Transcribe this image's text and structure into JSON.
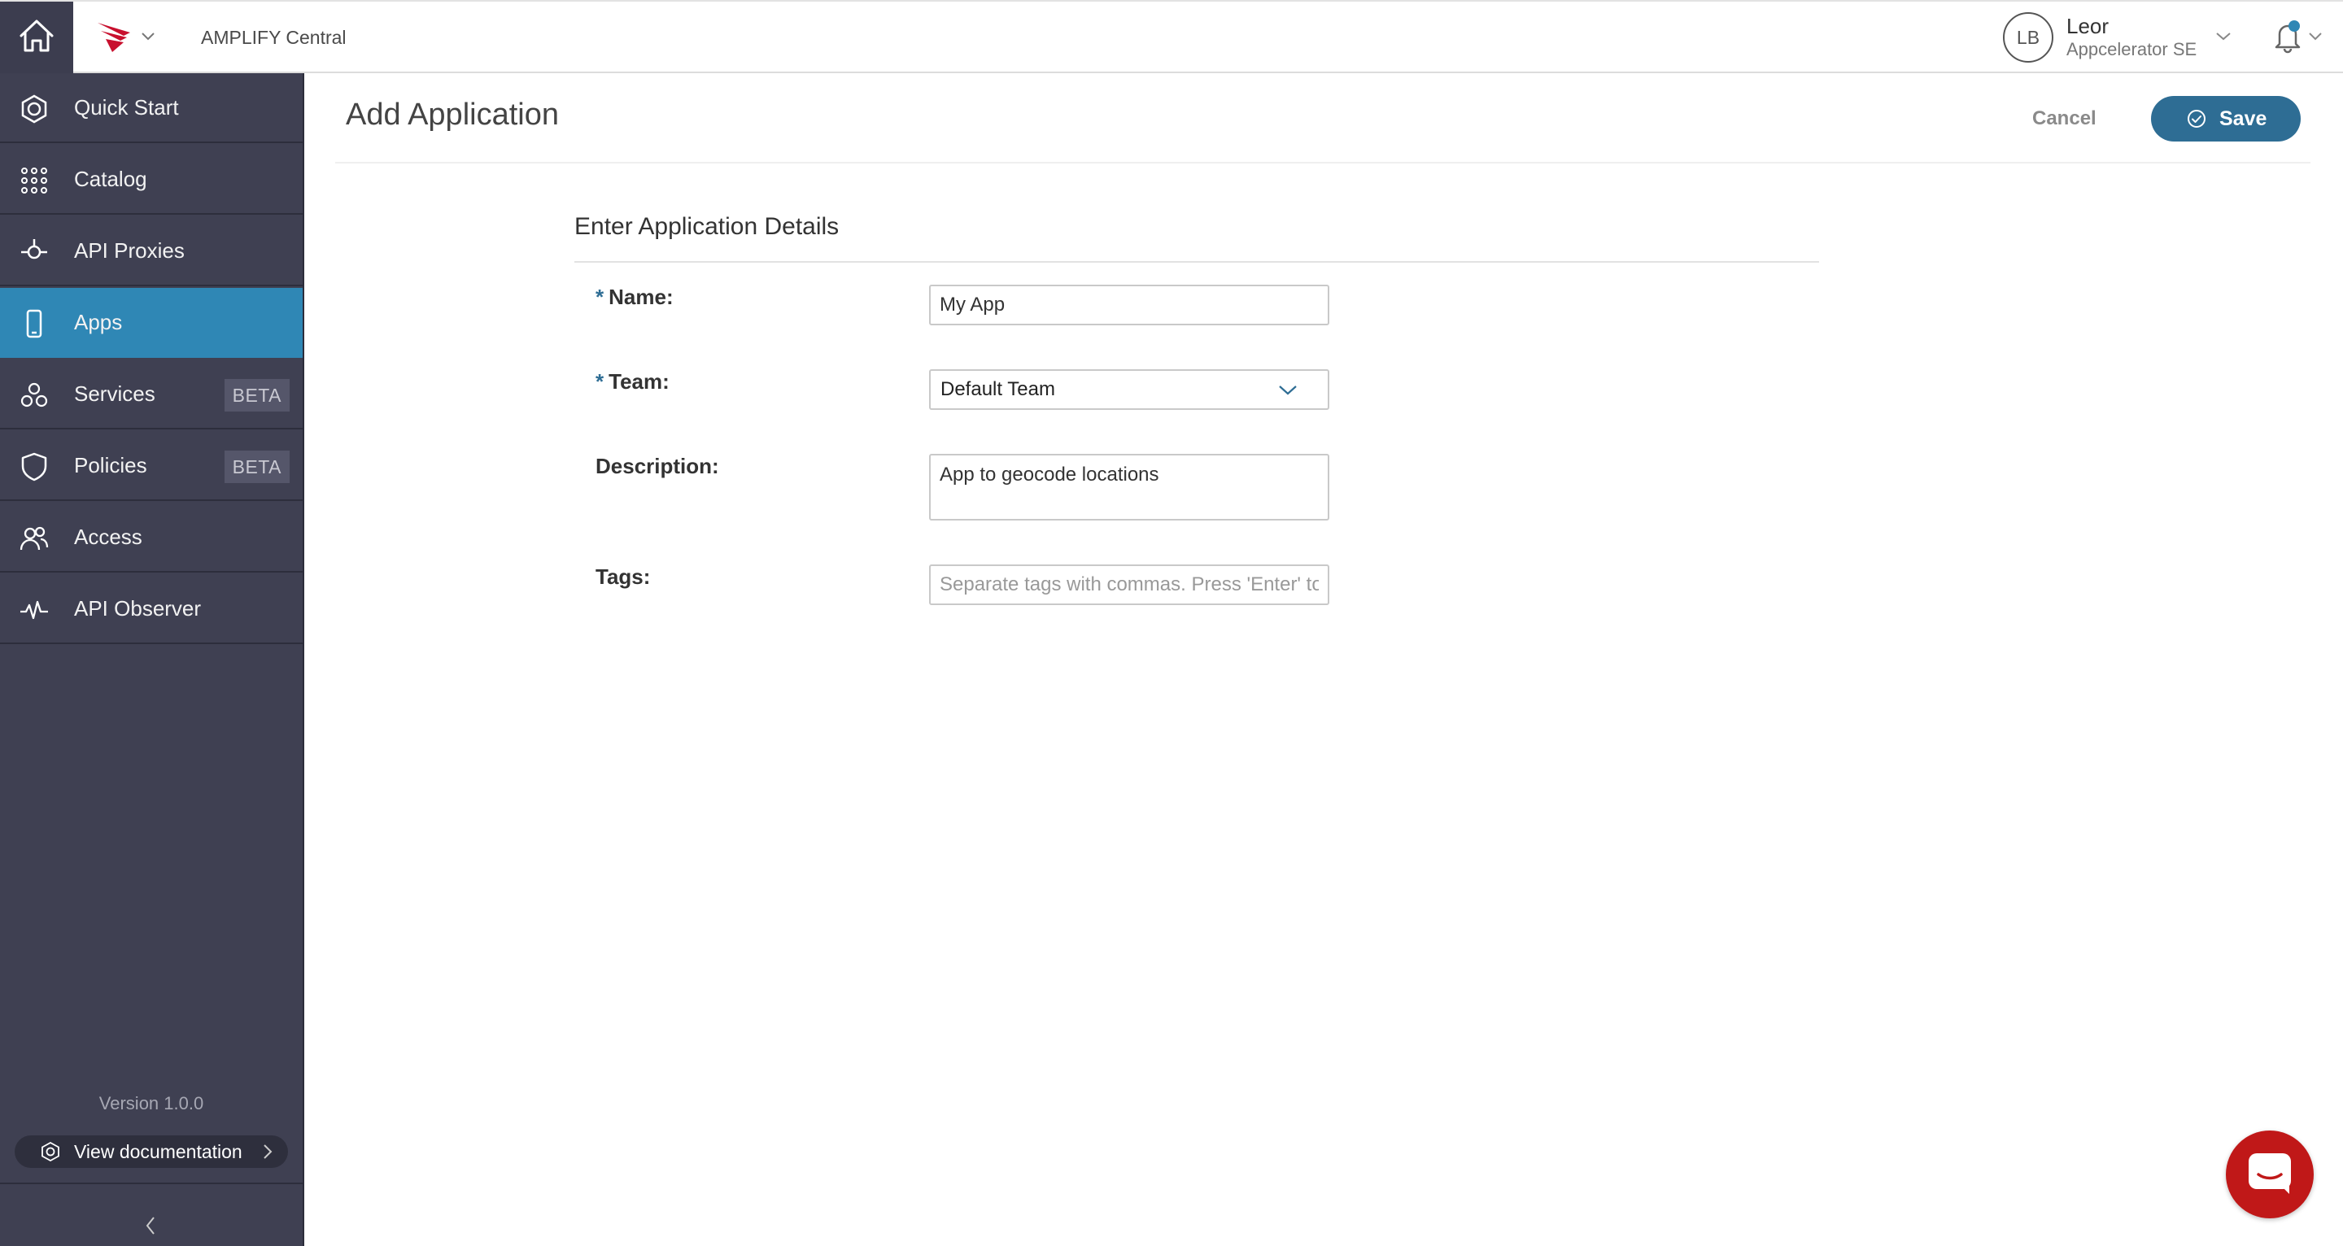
{
  "topbar": {
    "app_name": "AMPLIFY Central",
    "user": {
      "initials": "LB",
      "name": "Leor",
      "org": "Appcelerator SE"
    },
    "colors": {
      "home_bg": "#3c3d4f",
      "logo": "#c8102e",
      "notification_dot": "#2f87b5"
    }
  },
  "sidebar": {
    "items": [
      {
        "label": "Quick Start",
        "icon": "quick-start-icon",
        "active": false
      },
      {
        "label": "Catalog",
        "icon": "grid-icon",
        "active": false
      },
      {
        "label": "API Proxies",
        "icon": "api-proxy-icon",
        "active": false
      },
      {
        "label": "Apps",
        "icon": "phone-icon",
        "active": true
      },
      {
        "label": "Services",
        "icon": "services-icon",
        "active": false,
        "badge": "BETA"
      },
      {
        "label": "Policies",
        "icon": "shield-icon",
        "active": false,
        "badge": "BETA"
      },
      {
        "label": "Access",
        "icon": "users-icon",
        "active": false
      },
      {
        "label": "API Observer",
        "icon": "pulse-icon",
        "active": false
      }
    ],
    "version": "Version 1.0.0",
    "doc_button": "View documentation",
    "colors": {
      "bg": "#3f4052",
      "active": "#2f87b5"
    }
  },
  "page": {
    "title": "Add Application",
    "cancel_label": "Cancel",
    "save_label": "Save",
    "colors": {
      "save_bg": "#2e6d94",
      "required_star": "#2e6d94"
    }
  },
  "form": {
    "section_title": "Enter Application Details",
    "required_marker": "*",
    "name": {
      "label": "Name:",
      "value": "My App",
      "required": true
    },
    "team": {
      "label": "Team:",
      "value": "Default Team",
      "required": true
    },
    "description": {
      "label": "Description:",
      "value": "App to geocode locations"
    },
    "tags": {
      "label": "Tags:",
      "value": "",
      "placeholder": "Separate tags with commas. Press 'Enter' to add."
    }
  },
  "chat": {
    "icon": "chat-icon",
    "color": "#c01818"
  }
}
